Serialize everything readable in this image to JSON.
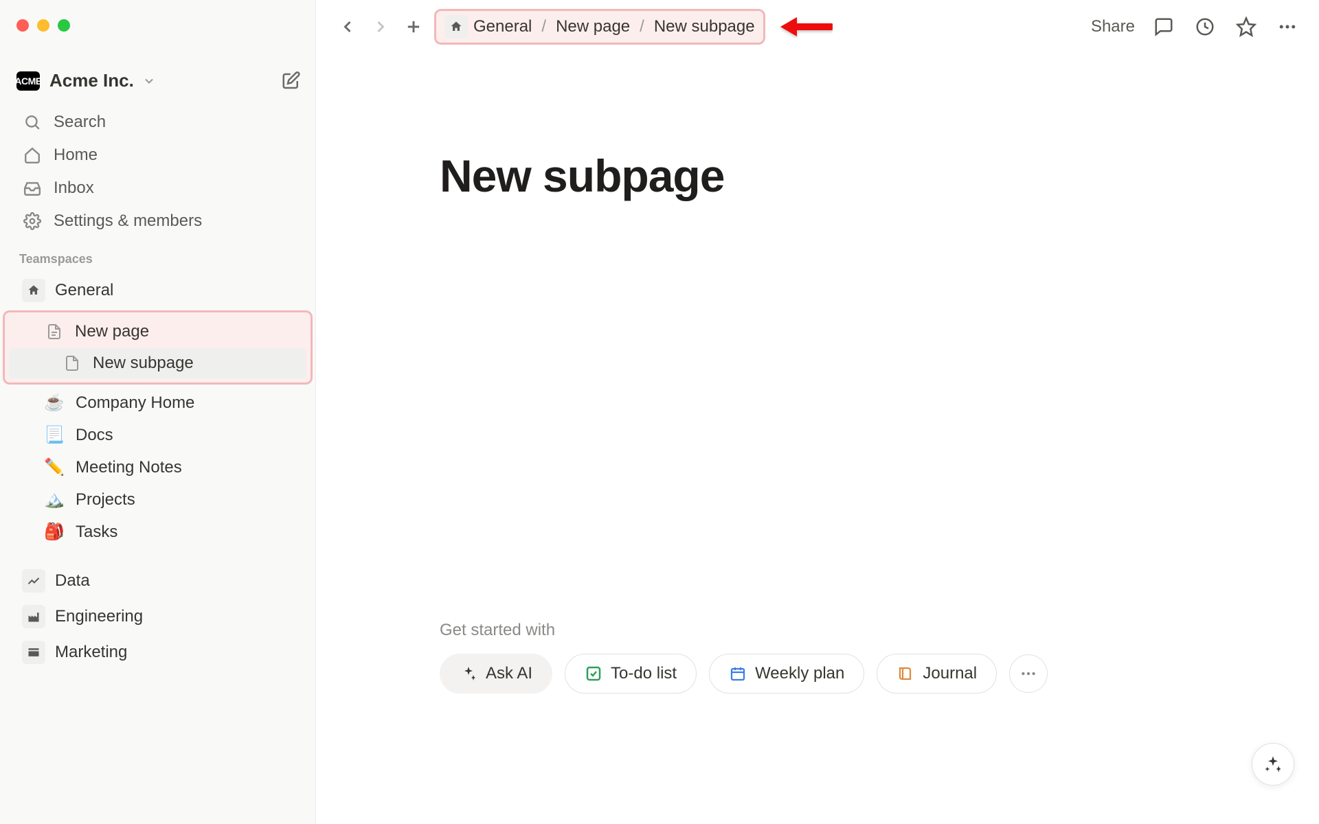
{
  "workspace": {
    "name": "Acme Inc.",
    "logo_text": "ACME"
  },
  "sidebar_top": {
    "search": "Search",
    "home": "Home",
    "inbox": "Inbox",
    "settings": "Settings & members"
  },
  "sidebar_section_label": "Teamspaces",
  "tree": {
    "general": "General",
    "new_page": "New page",
    "new_subpage": "New subpage",
    "company_home": {
      "emoji": "☕️",
      "label": "Company Home"
    },
    "docs": {
      "emoji": "📃",
      "label": "Docs"
    },
    "meeting_notes": {
      "emoji": "✏️",
      "label": "Meeting Notes"
    },
    "projects": {
      "emoji": "🏔️",
      "label": "Projects"
    },
    "tasks": {
      "emoji": "🎒",
      "label": "Tasks"
    }
  },
  "bottom": {
    "data": "Data",
    "engineering": "Engineering",
    "marketing": "Marketing"
  },
  "topbar": {
    "share": "Share",
    "breadcrumb": {
      "seg1": "General",
      "seg2": "New page",
      "seg3": "New subpage"
    }
  },
  "page": {
    "title": "New subpage"
  },
  "starter": {
    "label": "Get started with",
    "ask_ai": "Ask AI",
    "todo": "To-do list",
    "weekly": "Weekly plan",
    "journal": "Journal"
  }
}
